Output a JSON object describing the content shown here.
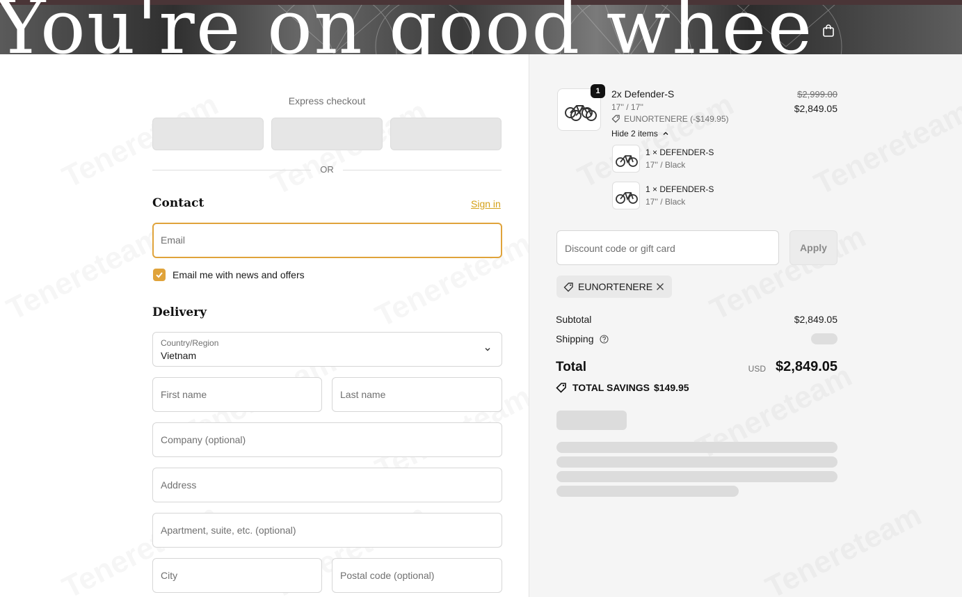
{
  "header": {
    "headline": "You're on good whee",
    "cart_icon": "shopping-bag-icon"
  },
  "express": {
    "label": "Express checkout",
    "separator": "OR"
  },
  "contact": {
    "title": "Contact",
    "sign_in": "Sign in",
    "email_placeholder": "Email",
    "newsletter_label": "Email me with news and offers",
    "newsletter_checked": true
  },
  "delivery": {
    "title": "Delivery",
    "country_label": "Country/Region",
    "country_value": "Vietnam",
    "first_name": "First name",
    "last_name": "Last name",
    "company": "Company (optional)",
    "address": "Address",
    "apartment": "Apartment, suite, etc. (optional)",
    "city": "City",
    "postal": "Postal code (optional)"
  },
  "order": {
    "quantity_badge": "1",
    "product_name": "2x Defender-S",
    "product_variant": "17'' / 17''",
    "product_discount": "EUNORTENERE (-$149.95)",
    "toggle_items": "Hide 2 items",
    "price_original": "$2,999.00",
    "price_current": "$2,849.05",
    "sub_items": [
      {
        "name": "1 × DEFENDER-S",
        "variant": "17'' / Black"
      },
      {
        "name": "1 × DEFENDER-S",
        "variant": "17'' / Black"
      }
    ]
  },
  "discount": {
    "placeholder": "Discount code or gift card",
    "apply": "Apply",
    "applied_code": "EUNORTENERE"
  },
  "summary": {
    "subtotal_label": "Subtotal",
    "subtotal_value": "$2,849.05",
    "shipping_label": "Shipping",
    "total_label": "Total",
    "currency": "USD",
    "total_value": "$2,849.05",
    "savings_label": "TOTAL SAVINGS",
    "savings_value": "$149.95"
  },
  "watermark": "Tenereteam",
  "colors": {
    "accent": "#e0a33a",
    "link": "#d4a017",
    "sidebar_bg": "#f5f5f5"
  }
}
